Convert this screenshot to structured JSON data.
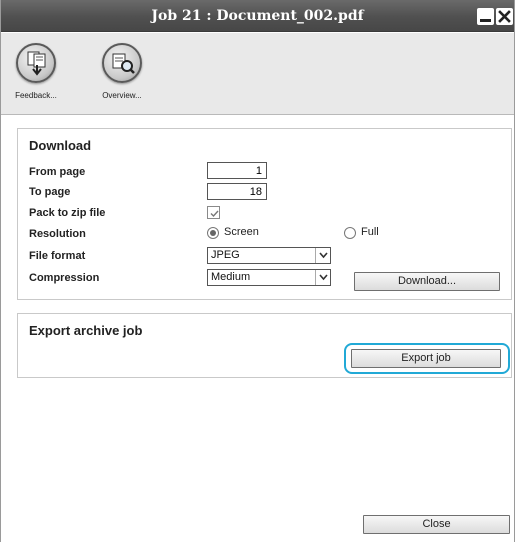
{
  "window": {
    "title": "Job 21 : Document_002.pdf",
    "minimize_icon": "minimize-icon",
    "close_icon": "close-icon"
  },
  "toolbar": {
    "items": [
      {
        "label": "Feedback...",
        "icon": "feedback-document-icon"
      },
      {
        "label": "Overview...",
        "icon": "overview-magnifier-icon"
      }
    ]
  },
  "download": {
    "title": "Download",
    "from_page_label": "From page",
    "from_page_value": "1",
    "to_page_label": "To page",
    "to_page_value": "18",
    "pack_zip_label": "Pack to zip file",
    "pack_zip_checked": true,
    "resolution_label": "Resolution",
    "resolution_options": [
      "Screen",
      "Full"
    ],
    "resolution_selected": "Screen",
    "file_format_label": "File format",
    "file_format_value": "JPEG",
    "compression_label": "Compression",
    "compression_value": "Medium",
    "download_button": "Download..."
  },
  "export": {
    "title": "Export archive job",
    "export_button": "Export job",
    "highlight_color": "#21a9d6"
  },
  "footer": {
    "close_button": "Close"
  }
}
